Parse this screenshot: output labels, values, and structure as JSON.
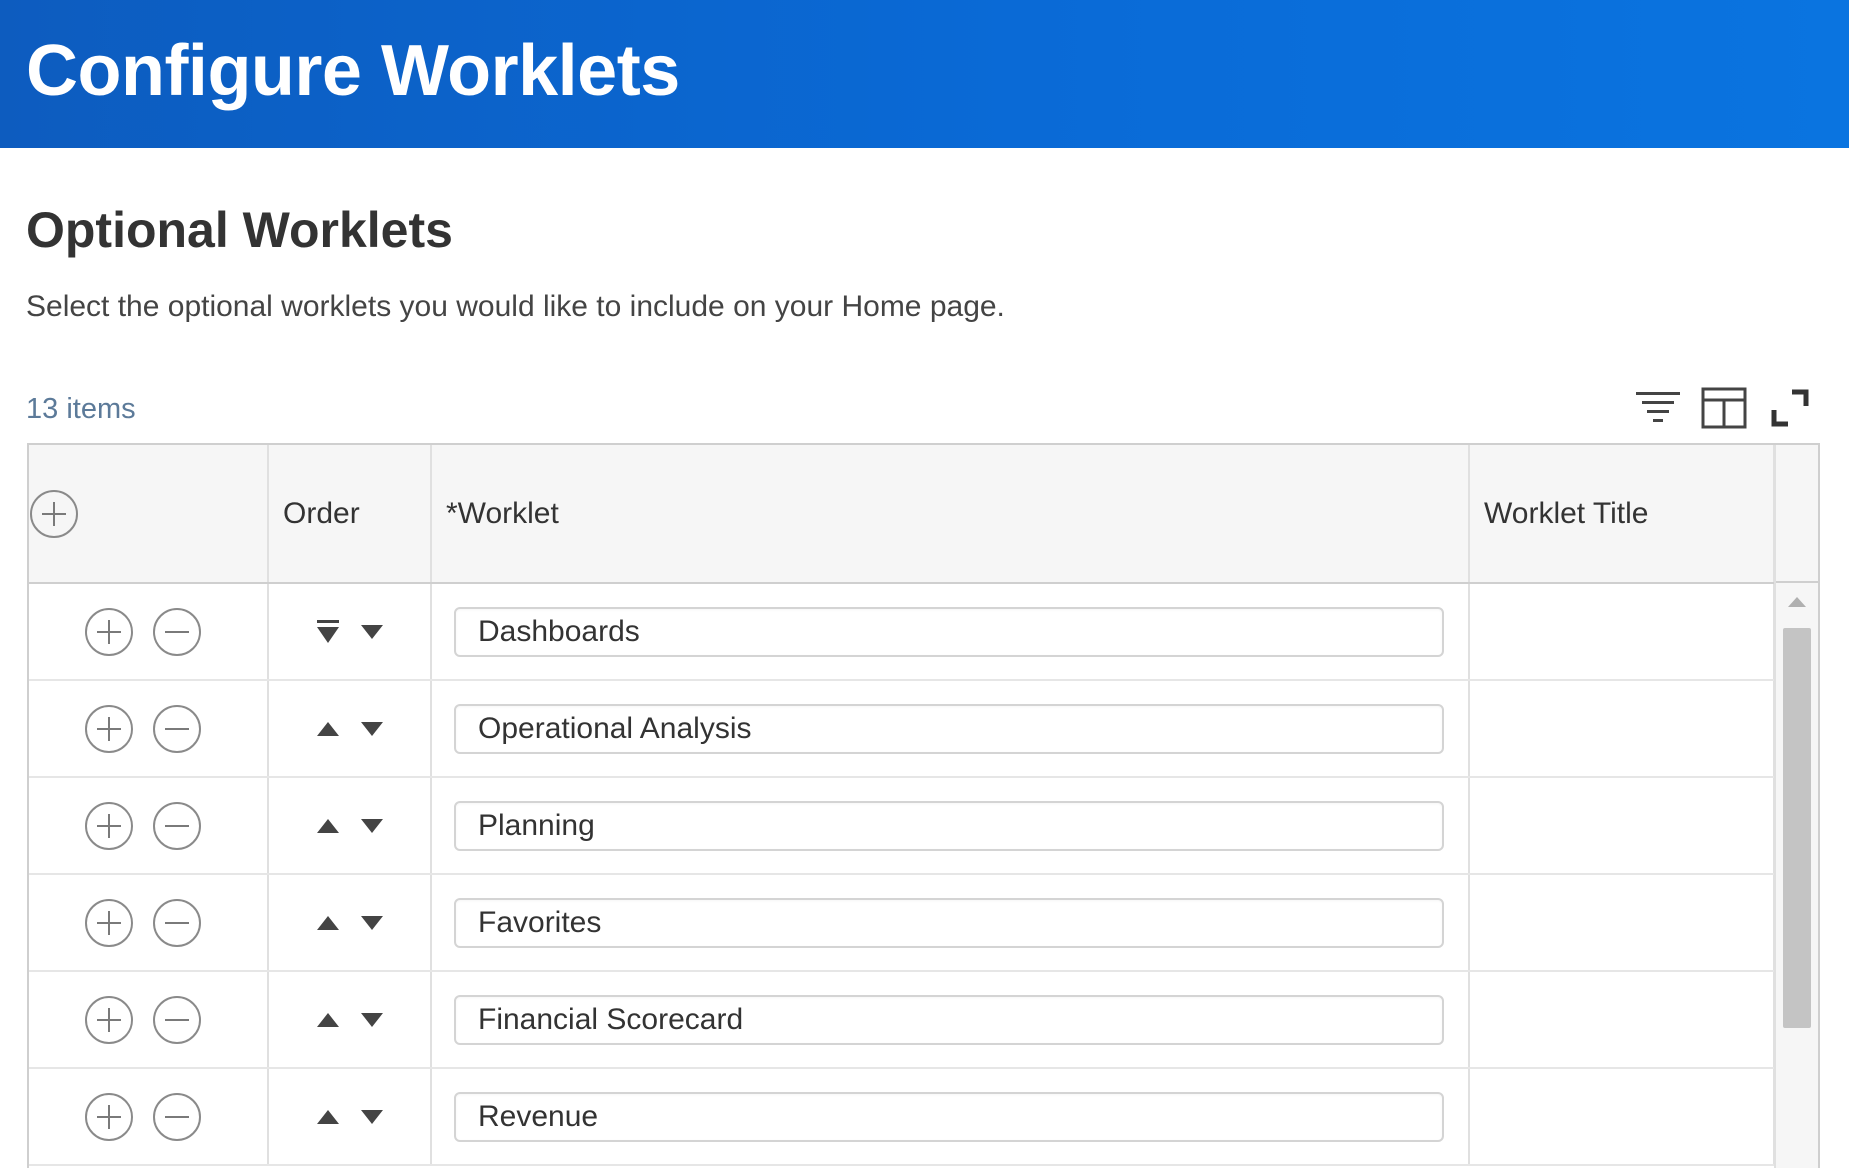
{
  "header": {
    "title": "Configure Worklets",
    "color": "#0a6ad6"
  },
  "section": {
    "title": "Optional Worklets",
    "description": "Select the optional worklets you would like to include on your Home page."
  },
  "grid": {
    "items_count": "13 items",
    "toolbar_icons": [
      "filter-icon",
      "column-layout-icon",
      "expand-icon"
    ],
    "columns": {
      "order": "Order",
      "worklet": "*Worklet",
      "worklet_title": "Worklet Title"
    },
    "rows": [
      {
        "worklet": "Dashboards",
        "worklet_title": ""
      },
      {
        "worklet": "Operational Analysis",
        "worklet_title": ""
      },
      {
        "worklet": "Planning",
        "worklet_title": ""
      },
      {
        "worklet": "Favorites",
        "worklet_title": ""
      },
      {
        "worklet": "Financial Scorecard",
        "worklet_title": ""
      },
      {
        "worklet": "Revenue",
        "worklet_title": ""
      }
    ]
  }
}
